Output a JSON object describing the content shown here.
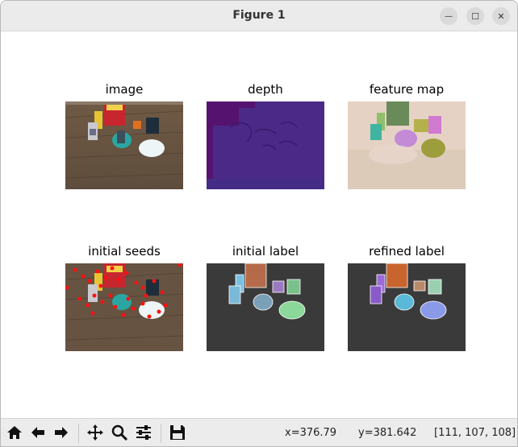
{
  "window": {
    "title": "Figure 1"
  },
  "titlebar": {
    "minimize_glyph": "—",
    "maximize_glyph": "☐",
    "close_glyph": "✕"
  },
  "panels": [
    {
      "title": "image"
    },
    {
      "title": "depth"
    },
    {
      "title": "feature map"
    },
    {
      "title": "initial seeds"
    },
    {
      "title": "initial label"
    },
    {
      "title": "refined label"
    }
  ],
  "toolbar": {
    "icons": [
      "home-icon",
      "back-arrow-icon",
      "forward-arrow-icon",
      "pan-icon",
      "zoom-icon",
      "configure-subplots-icon",
      "save-icon"
    ]
  },
  "status": {
    "x": "x=376.79",
    "y": "y=381.642",
    "pixel": "[111, 107, 108]"
  },
  "colors": {
    "depth_main": "#4a2a86",
    "depth_dark": "#5a0a6a",
    "seed_red": "#ff1010"
  }
}
